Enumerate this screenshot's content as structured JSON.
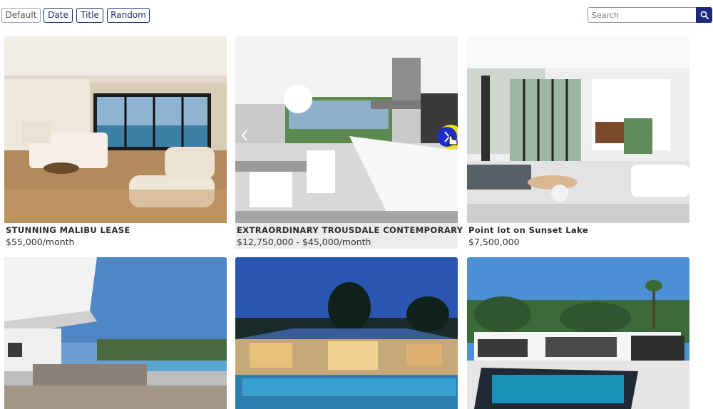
{
  "sort": {
    "buttons": [
      "Default",
      "Date",
      "Title",
      "Random"
    ]
  },
  "search": {
    "placeholder": "Search"
  },
  "listings": [
    {
      "title": "STUNNING MALIBU LEASE",
      "price": "$55,000/month"
    },
    {
      "title": "EXTRAORDINARY TROUSDALE CONTEMPORARY",
      "price": "$12,750,000 - $45,000/month"
    },
    {
      "title": "Point lot on Sunset Lake",
      "price": "$7,500,000"
    }
  ],
  "colors": {
    "accent": "#1b2a7a",
    "cursor_highlight": "#f5e400"
  },
  "icons": [
    "search-icon",
    "chevron-left-icon",
    "chevron-right-icon",
    "hand-cursor-icon"
  ]
}
